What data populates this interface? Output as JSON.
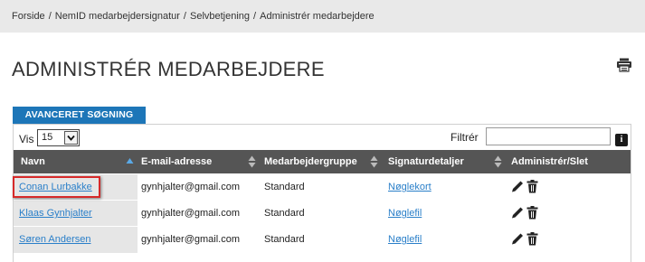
{
  "breadcrumb": {
    "items": [
      "Forside",
      "NemID medarbejdersignatur",
      "Selvbetjening",
      "Administrér medarbejdere"
    ],
    "separator": "/"
  },
  "page_title": "ADMINISTRÉR MEDARBEJDERE",
  "icons": {
    "print": "printer-icon",
    "info": "info-icon",
    "edit": "pencil-icon",
    "delete": "trash-icon",
    "sort": "sort-icon"
  },
  "colors": {
    "accent": "#1d76b8",
    "header_bg": "#555555",
    "link": "#2a7fc9",
    "highlight": "#d62929",
    "name_column_bg": "#e6e6e6",
    "breadcrumb_bg": "#e9e9e9"
  },
  "advanced_search_tab": "AVANCERET SØGNING",
  "table_controls": {
    "show_label": "Vis",
    "page_size": "15",
    "filter_label": "Filtrér",
    "filter_value": "",
    "info_glyph": "i"
  },
  "table": {
    "columns": [
      "Navn",
      "E-mail-adresse",
      "Medarbejdergruppe",
      "Signaturdetaljer",
      "Administrér/Slet"
    ],
    "rows": [
      {
        "name": "Conan Lurbakke",
        "email": "gynhjalter@gmail.com",
        "group": "Standard",
        "signature": "Nøglekort"
      },
      {
        "name": "Klaas Gynhjalter",
        "email": "gynhjalter@gmail.com",
        "group": "Standard",
        "signature": "Nøglefil"
      },
      {
        "name": "Søren Andersen",
        "email": "gynhjalter@gmail.com",
        "group": "Standard",
        "signature": "Nøglefil"
      }
    ]
  }
}
